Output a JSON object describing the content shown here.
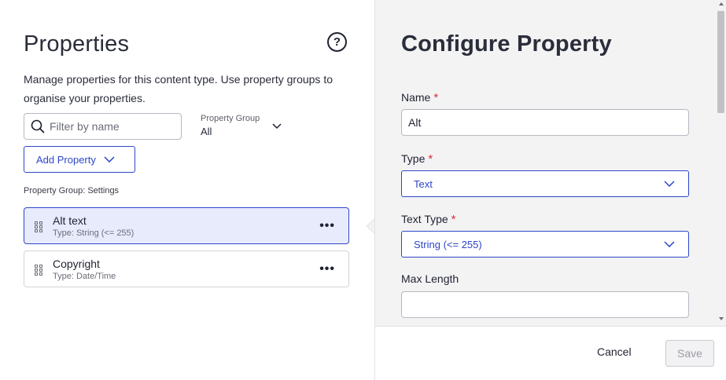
{
  "left_panel": {
    "title": "Properties",
    "help_label": "?",
    "description": "Manage properties for this content type. Use property groups to organise your properties.",
    "filter": {
      "placeholder": "Filter by name",
      "value": ""
    },
    "property_group": {
      "label": "Property Group",
      "value": "All"
    },
    "add_property_label": "Add Property",
    "group_label": "Property Group: Settings",
    "properties": [
      {
        "name": "Alt text",
        "type": "Type: String (<= 255)",
        "selected": true
      },
      {
        "name": "Copyright",
        "type": "Type: Date/Time",
        "selected": false
      }
    ],
    "more_label": "•••"
  },
  "right_panel": {
    "title": "Configure Property",
    "fields": {
      "name": {
        "label": "Name",
        "required_mark": "*",
        "value": "Alt"
      },
      "type": {
        "label": "Type",
        "required_mark": "*",
        "value": "Text"
      },
      "text_type": {
        "label": "Text Type",
        "required_mark": "*",
        "value": "String (<= 255)"
      },
      "max_length": {
        "label": "Max Length",
        "value": ""
      }
    },
    "footer": {
      "cancel_label": "Cancel",
      "save_label": "Save"
    }
  },
  "colors": {
    "accent": "#2e46c8",
    "selected_bg": "#e8ebfc",
    "required": "#d4303a",
    "panel_bg": "#f3f3f4"
  },
  "icons": [
    "help-icon",
    "search-icon",
    "chevron-down-icon",
    "drag-handle-icon",
    "more-icon"
  ]
}
